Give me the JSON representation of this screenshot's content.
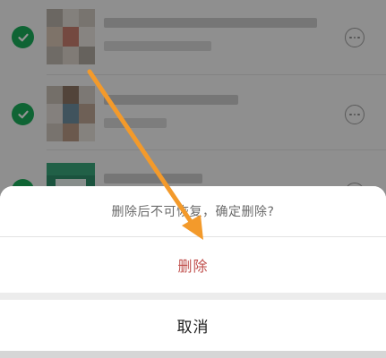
{
  "list": {
    "rows": [
      {
        "selected": true,
        "icon": "checkmark-icon",
        "more_icon": "more-options-icon"
      },
      {
        "selected": true,
        "icon": "checkmark-icon",
        "more_icon": "more-options-icon"
      },
      {
        "selected": true,
        "icon": "checkmark-icon",
        "more_icon": "more-options-icon"
      }
    ]
  },
  "dialog": {
    "message": "删除后不可恢复，确定删除?",
    "delete_label": "删除",
    "cancel_label": "取消"
  },
  "colors": {
    "check_green": "#1aad5b",
    "delete_red": "#c0504d",
    "annotation_orange": "#f39a2b"
  }
}
